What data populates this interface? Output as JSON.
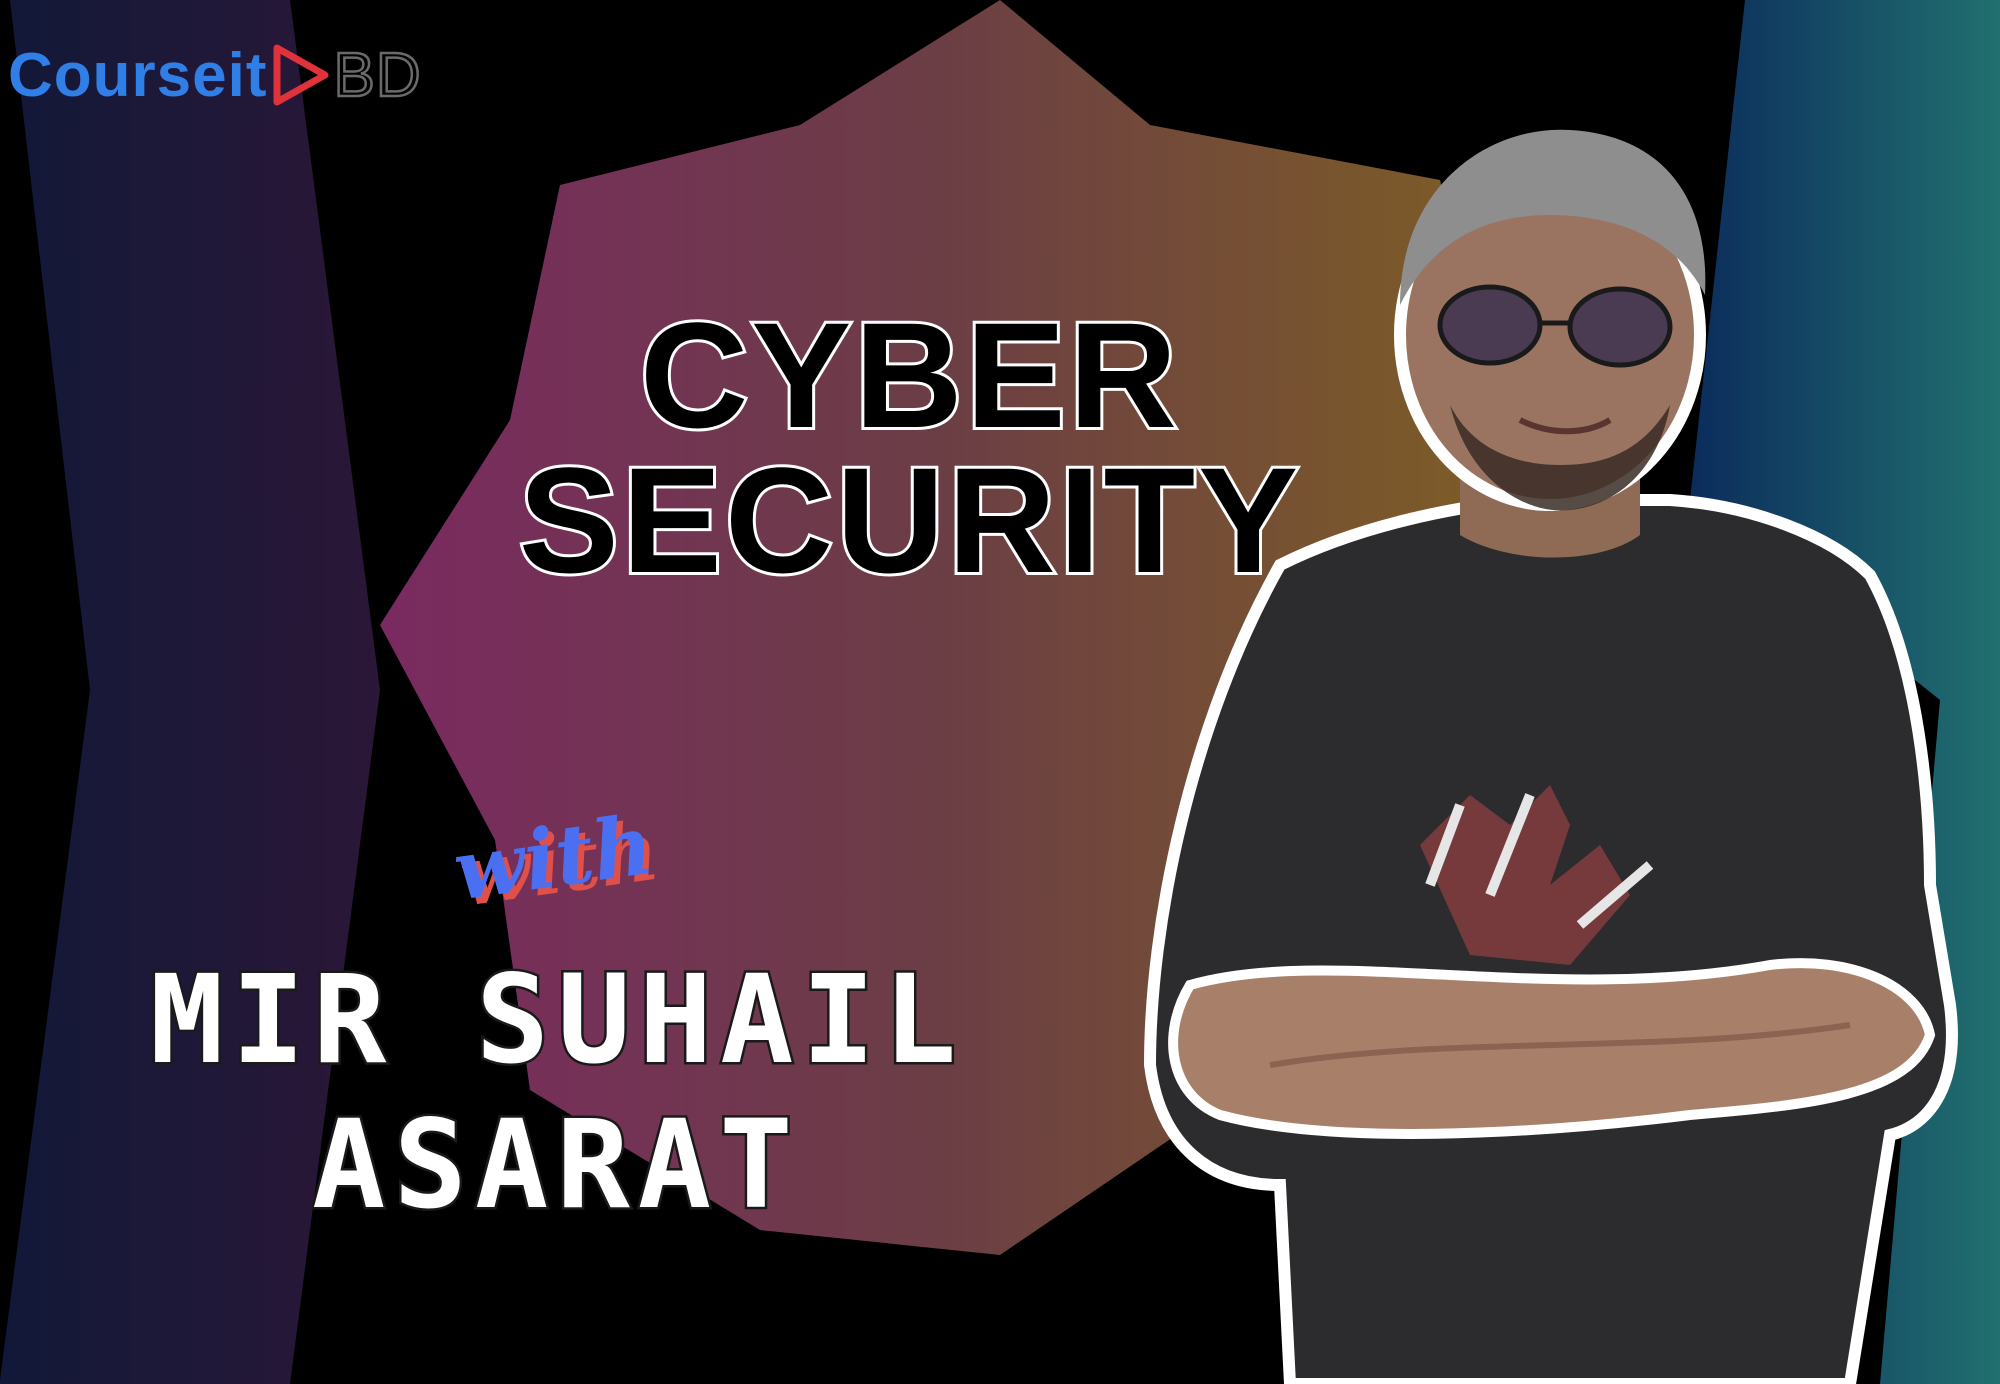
{
  "logo": {
    "main_text": "Courseit",
    "suffix_text": "BD",
    "icon": "play-triangle-icon",
    "colors": {
      "main": "#2f7fe6",
      "icon": "#e0323a",
      "suffix_outline": "#6a6a6a"
    }
  },
  "headline": {
    "line1": "CYBER",
    "line2": "SECURITY"
  },
  "presenter": {
    "with_label": "with",
    "name_line1": "MIR SUHAIL",
    "name_line2": "ASARAT",
    "photo": "presenter-photo"
  },
  "colors": {
    "background": "#000000",
    "left_band": [
      "#141a3a",
      "#2a1838"
    ],
    "right_band": [
      "#0d2d57",
      "#1f6a6e"
    ],
    "star_gradient": [
      "#7a2a5e",
      "#6a3f45",
      "#7c5a2a"
    ],
    "with_fill": "#4a6ff0",
    "with_shadow": "#e0504a"
  }
}
